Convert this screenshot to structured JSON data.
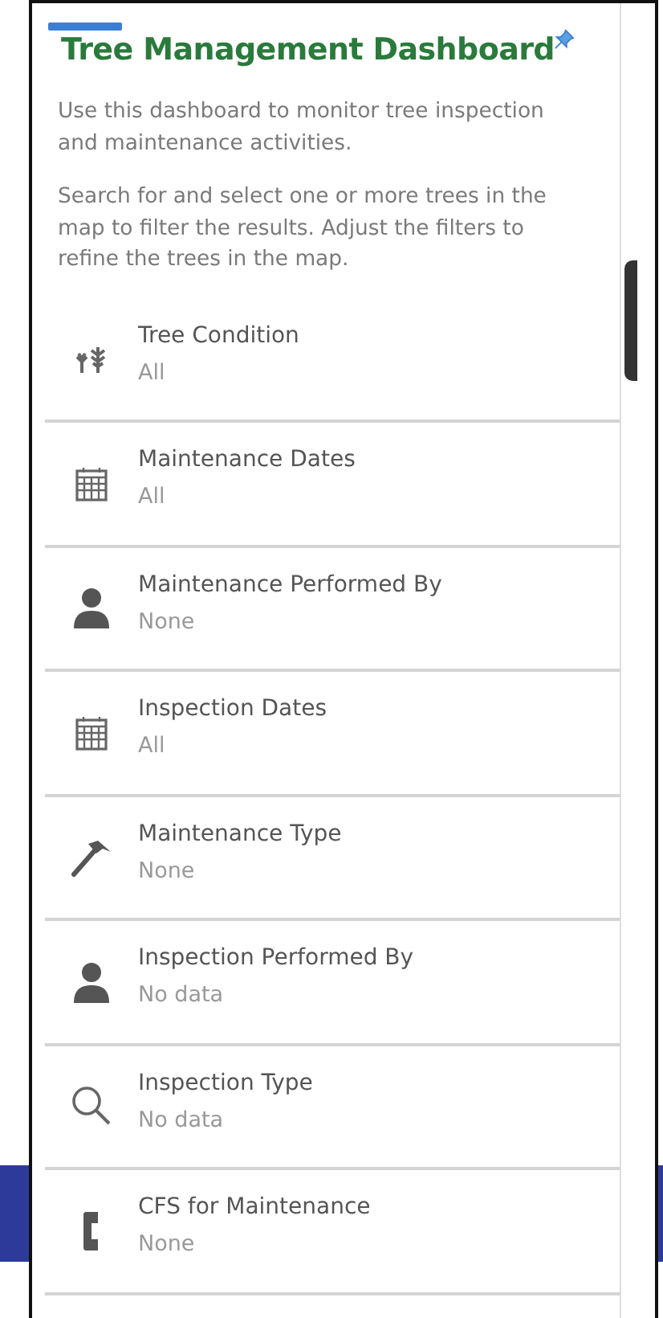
{
  "panel": {
    "title": "Tree Management Dashboard",
    "description": [
      "Use this dashboard to monitor tree inspection and maintenance activities.",
      "Search for and select one or more trees in the map to filter the results. Adjust the filters to refine the trees in the map."
    ]
  },
  "filters": [
    {
      "label": "Tree Condition",
      "value": "All"
    },
    {
      "label": "Maintenance Dates",
      "value": "All"
    },
    {
      "label": "Maintenance Performed By",
      "value": "None"
    },
    {
      "label": "Inspection Dates",
      "value": "All"
    },
    {
      "label": "Maintenance Type",
      "value": "None"
    },
    {
      "label": "Inspection Performed By",
      "value": "No data"
    },
    {
      "label": "Inspection Type",
      "value": "No data"
    },
    {
      "label": "CFS for Maintenance",
      "value": "None"
    }
  ]
}
